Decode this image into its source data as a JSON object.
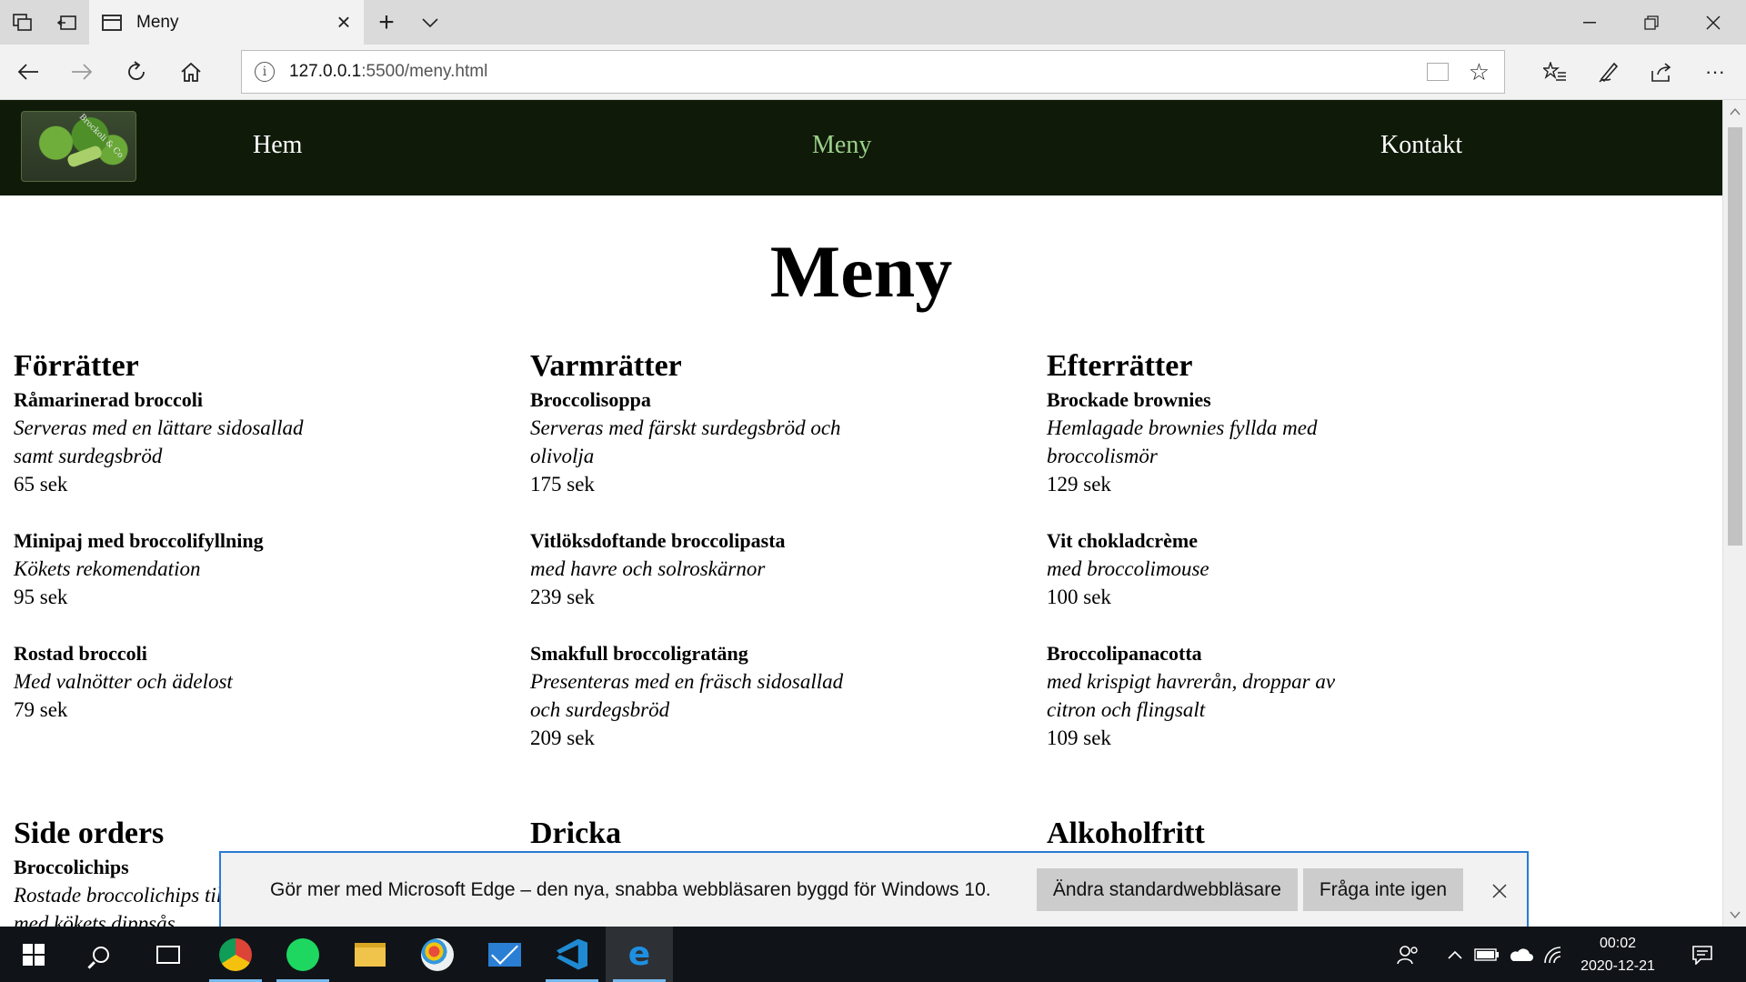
{
  "browser": {
    "tab_title": "Meny",
    "url_host": "127.0.0.1",
    "url_path": ":5500/meny.html"
  },
  "site": {
    "logo_text": "Brockoli & Co",
    "nav": [
      {
        "label": "Hem"
      },
      {
        "label": "Meny"
      },
      {
        "label": "Kontakt"
      }
    ],
    "active_nav": "Meny",
    "page_title": "Meny",
    "accent_color": "#9bd08a",
    "header_color": "#0f1a08"
  },
  "menu": {
    "forratter": {
      "title": "Förrätter",
      "dishes": [
        {
          "name": "Råmarinerad broccoli",
          "desc": "Serveras med en lättare sidosallad samt surdegsbröd",
          "price": "65 sek"
        },
        {
          "name": "Minipaj med broccolifyllning",
          "desc": "Kökets rekomendation",
          "price": "95 sek"
        },
        {
          "name": "Rostad broccoli",
          "desc": "Med valnötter och ädelost",
          "price": "79 sek"
        }
      ]
    },
    "varmratter": {
      "title": "Varmrätter",
      "dishes": [
        {
          "name": "Broccolisoppa",
          "desc": "Serveras med färskt surdegsbröd och olivolja",
          "price": "175 sek"
        },
        {
          "name": "Vitlöksdoftande broccolipasta",
          "desc": "med havre och solroskärnor",
          "price": "239 sek"
        },
        {
          "name": "Smakfull broccoligratäng",
          "desc": "Presenteras med en fräsch sidosallad och surdegsbröd",
          "price": "209 sek"
        }
      ]
    },
    "efterratter": {
      "title": "Efterrätter",
      "dishes": [
        {
          "name": "Brockade brownies",
          "desc": "Hemlagade brownies fyllda med broccolismör",
          "price": "129 sek"
        },
        {
          "name": "Vit chokladcrème",
          "desc": "med broccolimouse",
          "price": "100 sek"
        },
        {
          "name": "Broccolipanacotta",
          "desc": "med krispigt havrerån, droppar av citron och flingsalt",
          "price": "109 sek"
        }
      ]
    },
    "side_orders": {
      "title": "Side orders",
      "dishes": [
        {
          "name": "Broccolichips",
          "desc": "Rostade broccolichips till",
          "desc2": "med kökets dippsås"
        }
      ]
    },
    "dricka": {
      "title": "Dricka"
    },
    "alkoholfritt": {
      "title": "Alkoholfritt"
    }
  },
  "notification": {
    "message": "Gör mer med Microsoft Edge – den nya, snabba webbläsaren byggd för Windows 10.",
    "primary_button": "Ändra standardwebbläsare",
    "secondary_button": "Fråga inte igen"
  },
  "taskbar": {
    "time": "00:02",
    "date": "2020-12-21"
  }
}
